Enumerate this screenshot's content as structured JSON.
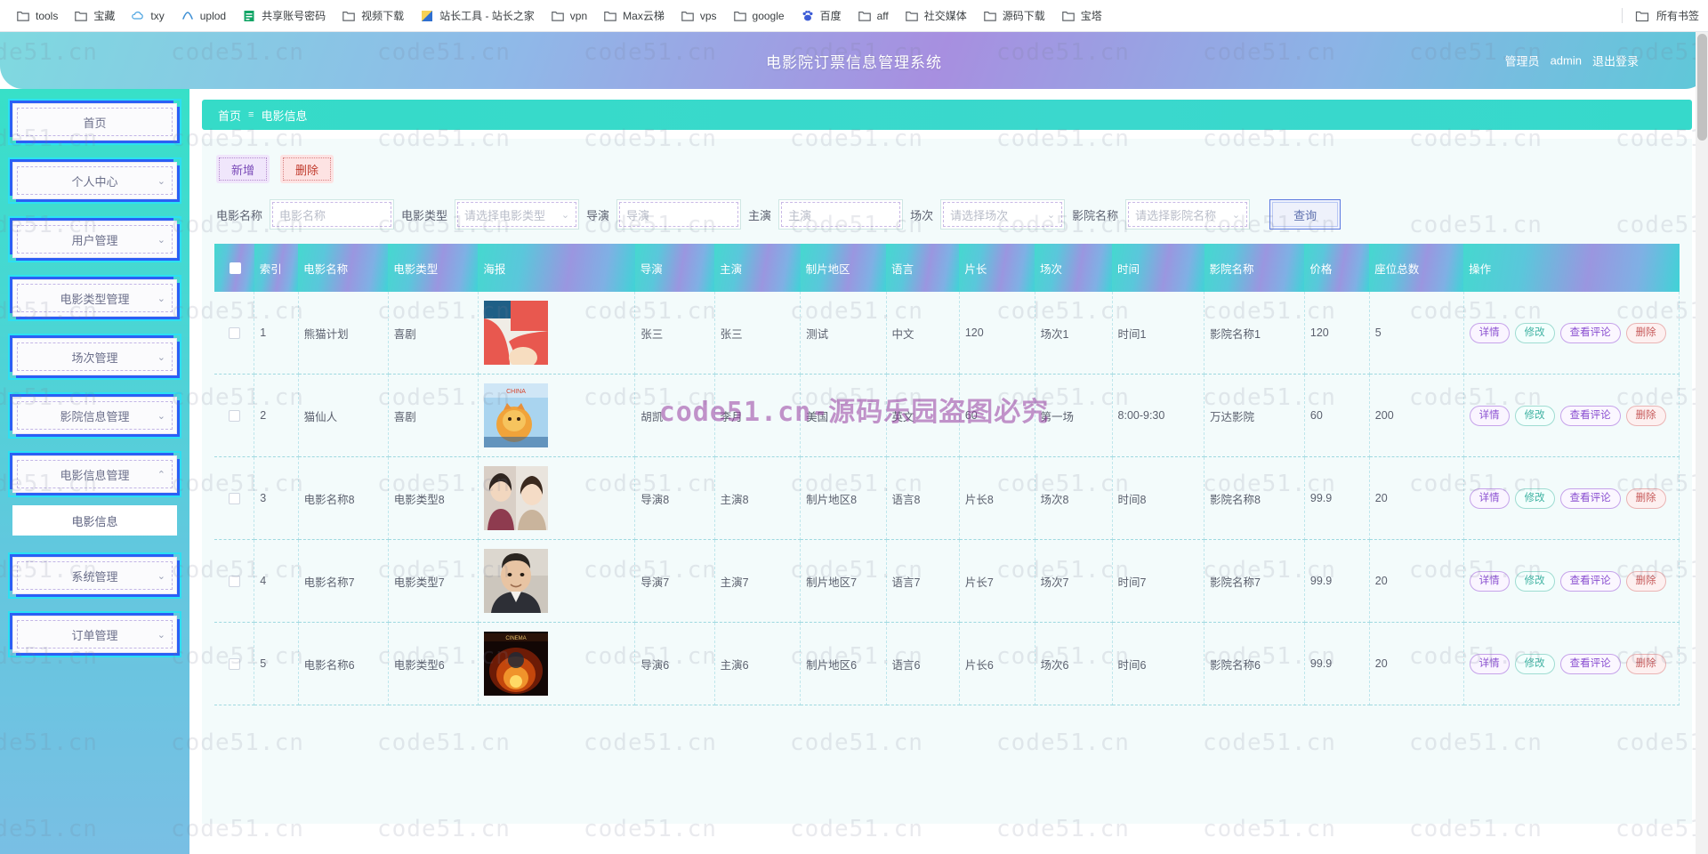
{
  "browser": {
    "bookmarks": [
      {
        "label": "tools",
        "icon": "folder-icon"
      },
      {
        "label": "宝藏",
        "icon": "folder-icon"
      },
      {
        "label": "txy",
        "icon": "cloud-icon"
      },
      {
        "label": "uplod",
        "icon": "wave-icon"
      },
      {
        "label": "共享账号密码",
        "icon": "sheet-icon"
      },
      {
        "label": "视频下载",
        "icon": "folder-icon"
      },
      {
        "label": "站长工具 - 站长之家",
        "icon": "chart-icon"
      },
      {
        "label": "vpn",
        "icon": "folder-icon"
      },
      {
        "label": "Max云梯",
        "icon": "folder-icon"
      },
      {
        "label": "vps",
        "icon": "folder-icon"
      },
      {
        "label": "google",
        "icon": "folder-icon"
      },
      {
        "label": "百度",
        "icon": "paw-icon"
      },
      {
        "label": "aff",
        "icon": "folder-icon"
      },
      {
        "label": "社交媒体",
        "icon": "folder-icon"
      },
      {
        "label": "源码下载",
        "icon": "folder-icon"
      },
      {
        "label": "宝塔",
        "icon": "folder-icon"
      }
    ],
    "all_bookmarks_label": "所有书签",
    "all_bookmarks_icon": "folder-icon"
  },
  "header": {
    "title": "电影院订票信息管理系统",
    "user_role": "管理员",
    "user_name": "admin",
    "logout_label": "退出登录"
  },
  "sidebar": {
    "items": [
      {
        "label": "首页",
        "expandable": false,
        "chevron": ""
      },
      {
        "label": "个人中心",
        "expandable": true,
        "chevron": "⌄"
      },
      {
        "label": "用户管理",
        "expandable": true,
        "chevron": "⌄"
      },
      {
        "label": "电影类型管理",
        "expandable": true,
        "chevron": "⌄"
      },
      {
        "label": "场次管理",
        "expandable": true,
        "chevron": "⌄"
      },
      {
        "label": "影院信息管理",
        "expandable": true,
        "chevron": "⌄"
      },
      {
        "label": "电影信息管理",
        "expandable": true,
        "chevron": "⌃",
        "active": true
      },
      {
        "label": "系统管理",
        "expandable": true,
        "chevron": "⌄"
      },
      {
        "label": "订单管理",
        "expandable": true,
        "chevron": "⌄"
      }
    ],
    "submenu": {
      "parent_index": 6,
      "label": "电影信息"
    }
  },
  "breadcrumb": {
    "home": "首页",
    "separator": "≡",
    "current": "电影信息"
  },
  "toolbar": {
    "add_label": "新增",
    "delete_label": "删除"
  },
  "filters": {
    "movie_name": {
      "label": "电影名称",
      "placeholder": "电影名称",
      "value": "",
      "type": "text"
    },
    "movie_type": {
      "label": "电影类型",
      "placeholder": "请选择电影类型",
      "value": "",
      "type": "select"
    },
    "director": {
      "label": "导演",
      "placeholder": "导演",
      "value": "",
      "type": "text"
    },
    "starring": {
      "label": "主演",
      "placeholder": "主演",
      "value": "",
      "type": "text"
    },
    "session": {
      "label": "场次",
      "placeholder": "请选择场次",
      "value": "",
      "type": "select"
    },
    "cinema_name": {
      "label": "影院名称",
      "placeholder": "请选择影院名称",
      "value": "",
      "type": "select"
    },
    "query_label": "查询",
    "caret_icon": "chevron-down-icon"
  },
  "table": {
    "columns": [
      "",
      "索引",
      "电影名称",
      "电影类型",
      "海报",
      "导演",
      "主演",
      "制片地区",
      "语言",
      "片长",
      "场次",
      "时间",
      "影院名称",
      "价格",
      "座位总数",
      "操作"
    ],
    "row_actions": {
      "detail": "详情",
      "edit": "修改",
      "comment": "查看评论",
      "remove": "删除"
    },
    "rows": [
      {
        "index": "1",
        "name": "熊猫计划",
        "type": "喜剧",
        "poster": "poster-panda",
        "director": "张三",
        "starring": "张三",
        "area": "测试",
        "language": "中文",
        "length": "120",
        "session": "场次1",
        "time": "时间1",
        "cinema": "影院名称1",
        "price": "120",
        "seats": "5"
      },
      {
        "index": "2",
        "name": "猫仙人",
        "type": "喜剧",
        "poster": "poster-cat",
        "director": "胡凯",
        "starring": "李月",
        "area": "美国",
        "language": "英文",
        "length": "60",
        "session": "第一场",
        "time": "8:00-9:30",
        "cinema": "万达影院",
        "price": "60",
        "seats": "200"
      },
      {
        "index": "3",
        "name": "电影名称8",
        "type": "电影类型8",
        "poster": "poster-portrait",
        "director": "导演8",
        "starring": "主演8",
        "area": "制片地区8",
        "language": "语言8",
        "length": "片长8",
        "session": "场次8",
        "time": "时间8",
        "cinema": "影院名称8",
        "price": "99.9",
        "seats": "20"
      },
      {
        "index": "4",
        "name": "电影名称7",
        "type": "电影类型7",
        "poster": "poster-man",
        "director": "导演7",
        "starring": "主演7",
        "area": "制片地区7",
        "language": "语言7",
        "length": "片长7",
        "session": "场次7",
        "time": "时间7",
        "cinema": "影院名称7",
        "price": "99.9",
        "seats": "20"
      },
      {
        "index": "5",
        "name": "电影名称6",
        "type": "电影类型6",
        "poster": "poster-fire",
        "director": "导演6",
        "starring": "主演6",
        "area": "制片地区6",
        "language": "语言6",
        "length": "片长6",
        "session": "场次6",
        "time": "时间6",
        "cinema": "影院名称6",
        "price": "99.9",
        "seats": "20"
      }
    ]
  },
  "watermarks": {
    "tile_text": "code51.cn",
    "center_text": "code51.cn-源码乐园盗图必究"
  },
  "colors": {
    "header_gradient_start": "#7fd9e0",
    "header_gradient_mid": "#a78fe0",
    "sidebar_start": "#37e0c8",
    "sidebar_end": "#79bfe4",
    "breadcrumb": "#36d9cb",
    "table_header": "#5ac7db",
    "accent_purple": "#8a4fd0",
    "accent_teal": "#41b3a3",
    "danger": "#c65a5a",
    "query_border": "#5d7ae0"
  }
}
